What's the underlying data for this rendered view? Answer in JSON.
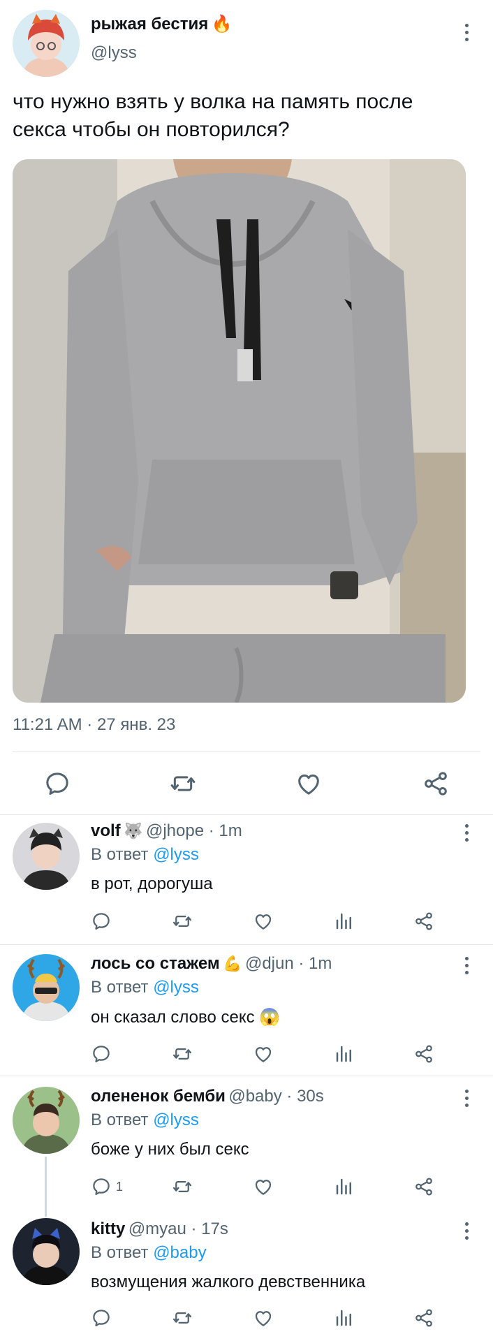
{
  "post": {
    "author_name": "рыжая бестия",
    "author_emoji": "🔥",
    "author_handle": "@lyss",
    "text_line1": "что нужно взять у волка на память после",
    "text_line2": "секса  чтобы он повторился?",
    "timestamp": "11:21 AM · 27 янв. 23",
    "image_alt": "grey PUMA hoodie photo"
  },
  "replies": [
    {
      "name": "volf",
      "emoji": "🐺",
      "handle": "@jhope",
      "time": "1m",
      "reply_prefix": "В ответ",
      "reply_to": "@lyss",
      "text": "в рот, дорогуша",
      "reply_count": ""
    },
    {
      "name": "лось со стажем",
      "emoji": "💪",
      "handle": "@djun",
      "time": "1m",
      "reply_prefix": "В ответ",
      "reply_to": "@lyss",
      "text": "он сказал слово секс",
      "text_emoji": "😱",
      "reply_count": ""
    },
    {
      "name": "олененок бемби",
      "emoji": "",
      "handle": "@baby",
      "time": "30s",
      "reply_prefix": "В ответ",
      "reply_to": "@lyss",
      "text": "боже у них был секс",
      "reply_count": "1"
    },
    {
      "name": "kitty",
      "emoji": "",
      "handle": "@myau",
      "time": "17s",
      "reply_prefix": "В ответ",
      "reply_to": "@baby",
      "text": "возмущения жалкого девственника",
      "reply_count": ""
    }
  ],
  "icons": {
    "reply": "reply-icon",
    "retweet": "retweet-icon",
    "like": "heart-icon",
    "views": "analytics-icon",
    "share": "share-icon",
    "more": "more-icon"
  },
  "colors": {
    "accent": "#1d9bf0",
    "muted": "#536471",
    "text": "#0f1419",
    "divider": "#e3e6e8"
  }
}
